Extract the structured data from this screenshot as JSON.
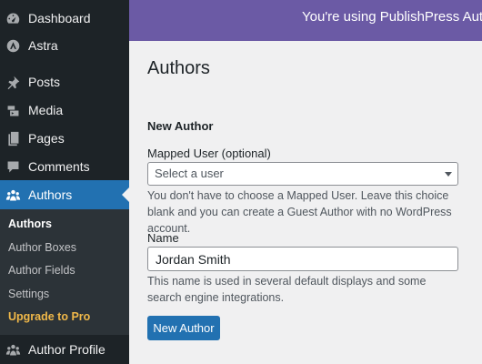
{
  "sidebar": {
    "items": [
      {
        "label": "Dashboard",
        "icon": "dashboard-icon"
      },
      {
        "label": "Astra",
        "icon": "astra-icon"
      },
      {
        "label": "Posts",
        "icon": "pin-icon"
      },
      {
        "label": "Media",
        "icon": "media-icon"
      },
      {
        "label": "Pages",
        "icon": "pages-icon"
      },
      {
        "label": "Comments",
        "icon": "comment-icon"
      },
      {
        "label": "Authors",
        "icon": "groups-icon"
      },
      {
        "label": "Author Profile",
        "icon": "groups-icon"
      }
    ],
    "active_item": "Authors",
    "submenu": [
      "Authors",
      "Author Boxes",
      "Author Fields",
      "Settings",
      "Upgrade to Pro"
    ]
  },
  "banner": {
    "text": "You're using PublishPress Authors"
  },
  "main": {
    "title": "Authors",
    "section_title": "New Author",
    "mapped_user": {
      "label": "Mapped User (optional)",
      "placeholder": "Select a user",
      "help": "You don't have to choose a Mapped User. Leave this choice blank and you can create a Guest Author with no WordPress account."
    },
    "name": {
      "label": "Name",
      "value": "Jordan Smith",
      "help": "This name is used in several default displays and some search engine integrations."
    },
    "submit_label": "New Author"
  },
  "colors": {
    "sidebar_bg": "#1d2327",
    "active": "#2271b1",
    "banner": "#6b5aa5",
    "upgrade": "#f0b849"
  }
}
